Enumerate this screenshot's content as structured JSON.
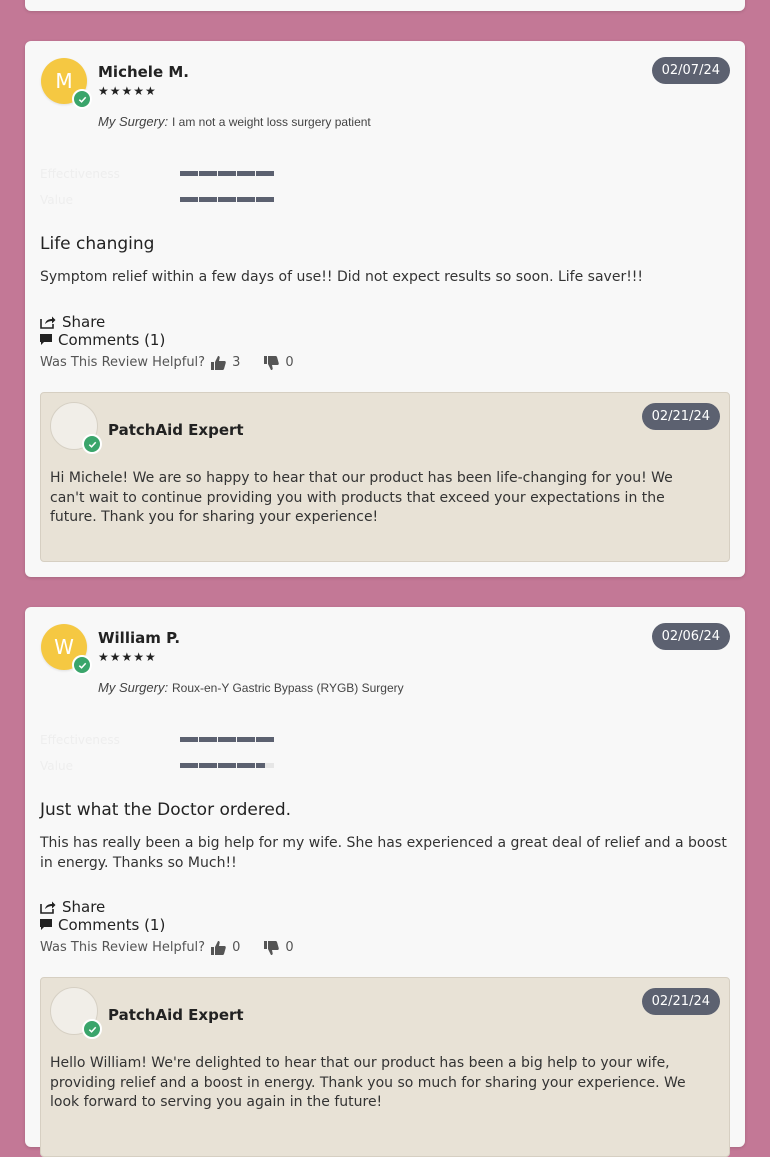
{
  "reviews": [
    {
      "initial": "M",
      "name": "Michele M.",
      "stars": "★★★★★",
      "date": "02/07/24",
      "surgery_label": "My Surgery:",
      "surgery_value": "I am not a weight loss surgery patient",
      "metrics": [
        {
          "label": "Effectiveness",
          "rating": 5
        },
        {
          "label": "Value",
          "rating": 5
        }
      ],
      "title": "Life changing",
      "body": "Symptom relief within a few days of use!! Did not expect results so soon. Life saver!!!",
      "share_label": "Share",
      "comments_label": "Comments (1)",
      "helpful_label": "Was This Review Helpful?",
      "helpful_yes": "3",
      "helpful_no": "0",
      "reply": {
        "name": "PatchAid Expert",
        "date": "02/21/24",
        "text": "Hi Michele! We are so happy to hear that our product has been life-changing for you! We can't wait to continue providing you with products that exceed your expectations in the future. Thank you for sharing your experience!"
      }
    },
    {
      "initial": "W",
      "name": "William P.",
      "stars": "★★★★★",
      "date": "02/06/24",
      "surgery_label": "My Surgery:",
      "surgery_value": "Roux-en-Y Gastric Bypass (RYGB) Surgery",
      "metrics": [
        {
          "label": "Effectiveness",
          "rating": 5
        },
        {
          "label": "Value",
          "rating": 4.5
        }
      ],
      "title": "Just what the Doctor ordered.",
      "body": "This has really been a big help for my wife. She has experienced a great deal of relief and a boost in energy. Thanks so Much!!",
      "share_label": "Share",
      "comments_label": "Comments (1)",
      "helpful_label": "Was This Review Helpful?",
      "helpful_yes": "0",
      "helpful_no": "0",
      "reply": {
        "name": "PatchAid Expert",
        "date": "02/21/24",
        "text": "Hello William! We're delighted to hear that our product has been a big help to your wife, providing relief and a boost in energy. Thank you so much for sharing your experience. We look forward to serving you again in the future!"
      }
    }
  ],
  "colors": {
    "page_bg": "#c37896",
    "avatar": "#f5c842",
    "verified": "#3aa56b",
    "date_pill": "#5c6170",
    "reply_bg": "#e8e2d6"
  }
}
